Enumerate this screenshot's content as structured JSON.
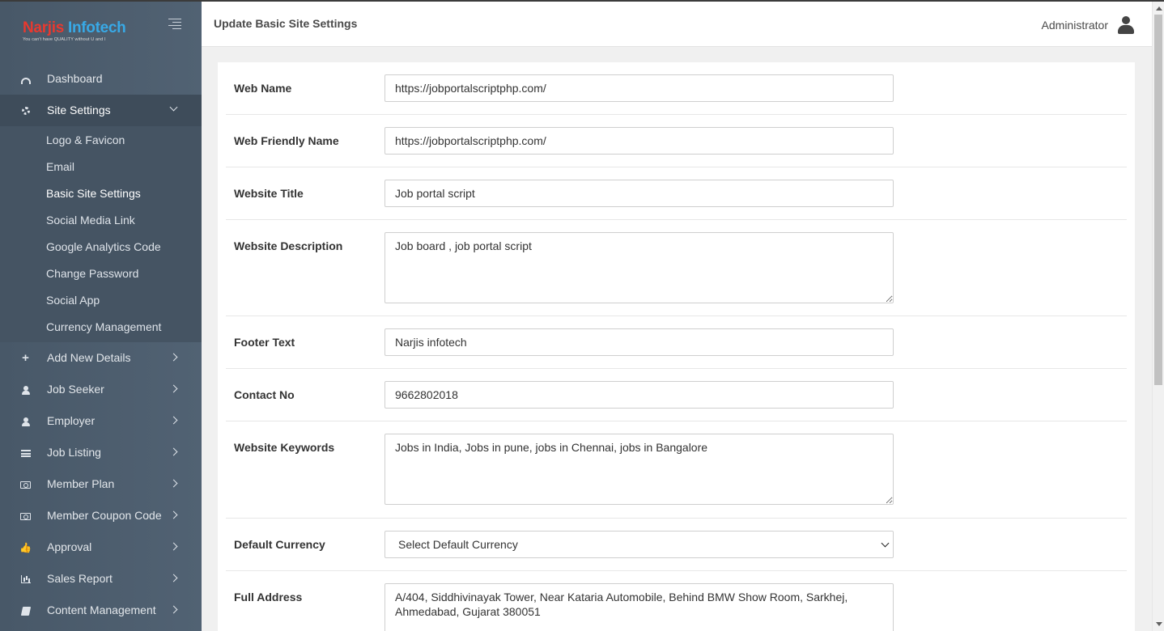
{
  "brand": {
    "logo_part1": "Narjis ",
    "logo_part2": "Infotech",
    "tagline": "You can't have QUALITY without U and I"
  },
  "header": {
    "title": "Update Basic Site Settings",
    "user": "Administrator"
  },
  "sidebar": {
    "items": [
      {
        "label": "Dashboard",
        "icon": "dashboard-icon"
      },
      {
        "label": "Site Settings",
        "icon": "cogs-icon",
        "open": true
      },
      {
        "label": "Add New Details",
        "icon": "plus-icon"
      },
      {
        "label": "Job Seeker",
        "icon": "user-icon"
      },
      {
        "label": "Employer",
        "icon": "user-icon"
      },
      {
        "label": "Job Listing",
        "icon": "list-icon"
      },
      {
        "label": "Member Plan",
        "icon": "money-icon"
      },
      {
        "label": "Member Coupon Code",
        "icon": "money-icon"
      },
      {
        "label": "Approval",
        "icon": "thumbs-up-icon"
      },
      {
        "label": "Sales Report",
        "icon": "bar-chart-icon"
      },
      {
        "label": "Content Management",
        "icon": "book-icon"
      }
    ],
    "site_settings_sub": [
      "Logo & Favicon",
      "Email",
      "Basic Site Settings",
      "Social Media Link",
      "Google Analytics Code",
      "Change Password",
      "Social App",
      "Currency Management"
    ],
    "active_sub": "Basic Site Settings"
  },
  "form": {
    "web_name": {
      "label": "Web Name",
      "value": "https://jobportalscriptphp.com/"
    },
    "web_friendly_name": {
      "label": "Web Friendly Name",
      "value": "https://jobportalscriptphp.com/"
    },
    "website_title": {
      "label": "Website Title",
      "value": "Job portal script"
    },
    "website_description": {
      "label": "Website Description",
      "value": "Job board , job portal script"
    },
    "footer_text": {
      "label": "Footer Text",
      "value": "Narjis infotech"
    },
    "contact_no": {
      "label": "Contact No",
      "value": "9662802018"
    },
    "website_keywords": {
      "label": "Website Keywords",
      "value": "Jobs in India, Jobs in pune, jobs in Chennai, jobs in Bangalore"
    },
    "default_currency": {
      "label": "Default Currency",
      "value": "Select Default Currency"
    },
    "full_address": {
      "label": "Full Address",
      "value": "A/404, Siddhivinayak Tower, Near Kataria Automobile, Behind BMW Show Room, Sarkhej, Ahmedabad, Gujarat 380051"
    }
  }
}
